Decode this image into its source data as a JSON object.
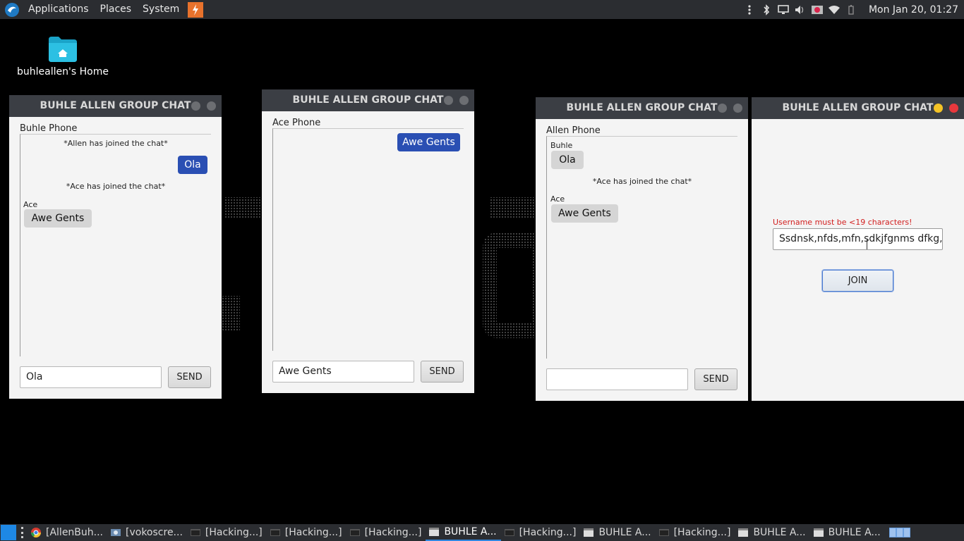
{
  "panel": {
    "menus": [
      "Applications",
      "Places",
      "System"
    ],
    "clock": "Mon Jan 20, 01:27"
  },
  "desktop": {
    "home_icon_label": "buhleallen's Home"
  },
  "windows": [
    {
      "title": "BUHLE ALLEN GROUP CHAT",
      "phone": "Buhle Phone",
      "system_messages": [
        "*Allen has joined the chat*",
        "*Ace has joined the chat*"
      ],
      "outgoing": [
        "Ola"
      ],
      "incoming": [
        {
          "sender": "Ace",
          "text": "Awe Gents"
        }
      ],
      "input_value": "Ola",
      "send_label": "SEND"
    },
    {
      "title": "BUHLE ALLEN GROUP CHAT",
      "phone": "Ace Phone",
      "outgoing": [
        "Awe Gents"
      ],
      "input_value": "Awe Gents",
      "send_label": "SEND"
    },
    {
      "title": "BUHLE ALLEN GROUP CHAT",
      "phone": "Allen Phone",
      "system_messages": [
        "*Ace has joined the chat*"
      ],
      "incoming": [
        {
          "sender": "Buhle",
          "text": "Ola"
        },
        {
          "sender": "Ace",
          "text": "Awe Gents"
        }
      ],
      "input_value": "",
      "send_label": "SEND"
    },
    {
      "title": "BUHLE ALLEN GROUP CHAT",
      "error": "Username must be <19 characters!",
      "username_value": "Ssdnsk,nfds,mfn,sdkjfgnms dfkg,m",
      "join_label": "JOIN"
    }
  ],
  "taskbar": {
    "tasks": [
      "[AllenBuh...",
      "[vokoscre...",
      "[Hacking...]",
      "[Hacking...]",
      "[Hacking...]",
      "BUHLE A...",
      "[Hacking...]",
      "BUHLE A...",
      "[Hacking...]",
      "BUHLE A...",
      "BUHLE A..."
    ],
    "active_index": 5
  }
}
